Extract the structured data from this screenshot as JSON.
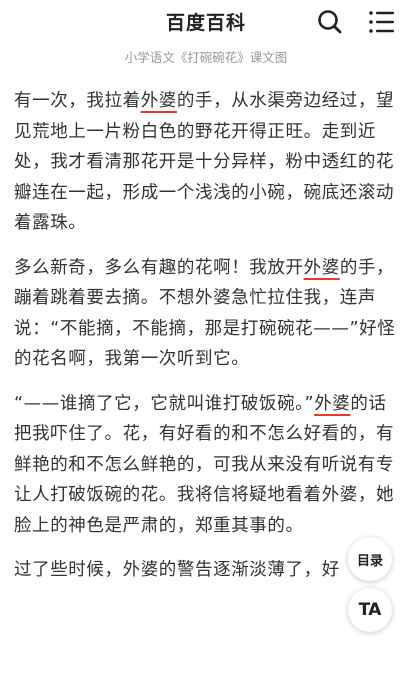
{
  "header": {
    "title": "百度百科"
  },
  "caption": "小学语文《打碗碗花》课文图",
  "paragraphs": [
    {
      "a": "有一次，我拉着",
      "b": "外婆",
      "c": "的手，从水渠旁边经过，望见荒地上一片粉白色的野花开得正旺。走到近处，我才看清那花开是十分异样，粉中透红的花瓣连在一起，形成一个浅浅的小碗，碗底还滚动着露珠。"
    },
    {
      "a": "多么新奇，多么有趣的花啊！我放开",
      "b": "外婆",
      "c": "的手，蹦着跳着要去摘。不想外婆急忙拉住我，连声说：“不能摘，不能摘，那是打碗碗花——”好怪的花名啊，我第一次听到它。"
    },
    {
      "a": "“——谁摘了它，它就叫谁打破饭碗。”",
      "b": "外婆",
      "c": "的话把我吓住了。花，有好看的和不怎么好看的，有鲜艳的和不怎么鲜艳的，可我从来没有听说有专让人打破饭碗的花。我将信将疑地看着外婆，她脸上的神色是严肃的，郑重其事的。"
    },
    {
      "a": "过了些时候，外婆的警告逐渐淡薄了，好",
      "b": "",
      "c": ""
    }
  ],
  "floating": {
    "toc_label": "目录",
    "ta_label_t": "T",
    "ta_label_a": "A"
  },
  "colors": {
    "underline": "#e33b2e",
    "text": "#333333",
    "caption": "#9a9a9a"
  },
  "icons": [
    "search-icon",
    "menu-icon"
  ]
}
